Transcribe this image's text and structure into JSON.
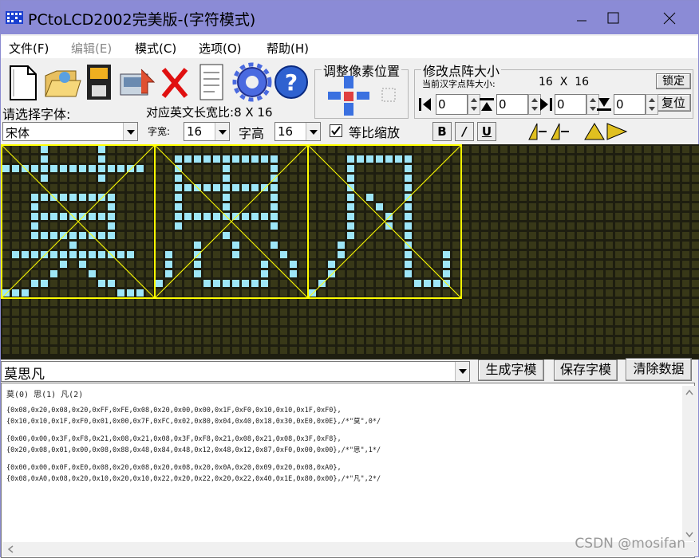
{
  "window": {
    "title": "PCtoLCD2002完美版-(字符模式)"
  },
  "menu": {
    "items": [
      "文件(F)",
      "编辑(E)",
      "模式(C)",
      "选项(O)",
      "帮助(H)"
    ]
  },
  "toolbar": {
    "icons": [
      "new-file-icon",
      "open-folder-icon",
      "save-icon",
      "download-icon",
      "delete-icon",
      "notes-icon",
      "settings-gear-icon",
      "help-icon"
    ]
  },
  "pixel_adjust": {
    "title": "调整像素位置"
  },
  "matrix_size": {
    "title": "修改点阵大小",
    "current_label": "当前汉字点阵大小:",
    "current_value": "16  X  16",
    "lock_label": "锁定",
    "reset_label": "复位",
    "spinners": [
      "0",
      "0",
      "0",
      "0"
    ]
  },
  "font": {
    "prompt": "请选择字体:",
    "name": "宋体",
    "english_ratio_label": "对应英文长宽比:",
    "english_ratio_value": "8 X 16",
    "width_label": "字宽:",
    "width_value": "16",
    "height_label": "字高",
    "height_value": "16",
    "proportional_label": "等比缩放",
    "proportional_checked": true,
    "format_buttons": [
      "B",
      "/",
      "U"
    ]
  },
  "colors": {
    "grid_bg": "#1e1e10",
    "grid_cell": "#383818",
    "pixel_on": "#9ee6f8",
    "glyph_border": "#ffff00"
  },
  "input": {
    "text": "莫思凡",
    "generate_label": "生成字模",
    "save_label": "保存字模",
    "clear_label": "清除数据"
  },
  "output": {
    "header": "莫(0) 思(1) 凡(2)",
    "lines": [
      "{0x08,0x20,0x08,0x20,0xFF,0xFE,0x08,0x20,0x00,0x00,0x1F,0xF0,0x10,0x10,0x1F,0xF0},",
      "{0x10,0x10,0x1F,0xF0,0x01,0x00,0x7F,0xFC,0x02,0x80,0x04,0x40,0x18,0x30,0xE0,0x0E},/*\"莫\",0*/",
      "{0x00,0x00,0x3F,0xF8,0x21,0x08,0x21,0x08,0x3F,0xF8,0x21,0x08,0x21,0x08,0x3F,0xF8},",
      "{0x20,0x08,0x01,0x00,0x08,0x88,0x48,0x84,0x48,0x12,0x48,0x12,0x87,0xF0,0x00,0x00},/*\"思\",1*/",
      "{0x00,0x00,0x0F,0xE0,0x08,0x20,0x08,0x20,0x08,0x20,0x0A,0x20,0x09,0x20,0x08,0xA0},",
      "{0x08,0xA0,0x08,0x20,0x10,0x20,0x10,0x22,0x20,0x22,0x20,0x22,0x40,0x1E,0x80,0x00},/*\"凡\",2*/"
    ]
  },
  "watermark": "CSDN @mosifan"
}
